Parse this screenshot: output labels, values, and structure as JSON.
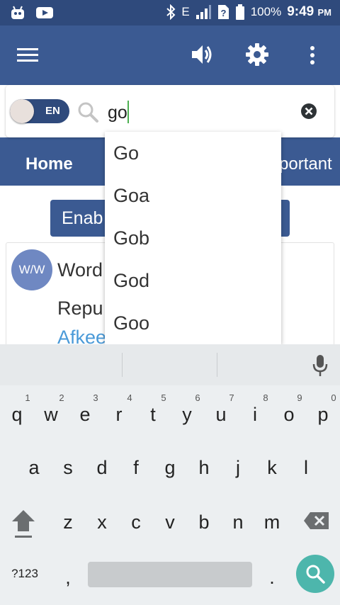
{
  "status_bar": {
    "network": "E",
    "battery": "100%",
    "time": "9:49",
    "ampm": "PM"
  },
  "search": {
    "toggle_label": "EN",
    "query": "go"
  },
  "tabs": {
    "home": "Home",
    "important": "portant"
  },
  "content": {
    "enable_button": "Enab",
    "avatar_text": "W/W",
    "word_title": "Word",
    "word_sub": "Repu",
    "word_link": "Afkee"
  },
  "suggestions": [
    "Go",
    "Goa",
    "Gob",
    "God",
    "Goo"
  ],
  "keyboard": {
    "numbers": [
      "1",
      "2",
      "3",
      "4",
      "5",
      "6",
      "7",
      "8",
      "9",
      "0"
    ],
    "row1": [
      "q",
      "w",
      "e",
      "r",
      "t",
      "y",
      "u",
      "i",
      "o",
      "p"
    ],
    "row2": [
      "a",
      "s",
      "d",
      "f",
      "g",
      "h",
      "j",
      "k",
      "l"
    ],
    "row3": [
      "z",
      "x",
      "c",
      "v",
      "b",
      "n",
      "m"
    ],
    "symbols_key": "?123",
    "comma": ",",
    "period": "."
  },
  "colors": {
    "app_bar": "#3b5a92",
    "status_bar": "#2f4a7c",
    "accent_caret": "#4caf50",
    "search_fab": "#4db6ac",
    "link": "#4a9ad8"
  }
}
